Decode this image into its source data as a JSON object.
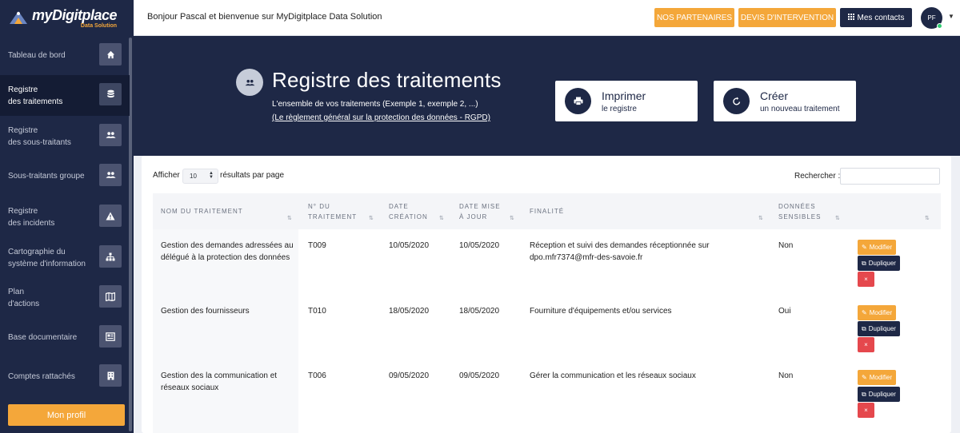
{
  "app": {
    "logo": {
      "main": "myDigitplace",
      "sub": "Data Solution"
    },
    "greeting": "Bonjour Pascal et bienvenue sur MyDigitplace Data Solution"
  },
  "topbar": {
    "partners_label": "NOS PARTENAIRES",
    "devis_label": "DEVIS D'INTERVENTION",
    "contacts_label": "Mes contacts",
    "avatar_initials": "PF"
  },
  "sidebar": {
    "items": [
      {
        "label": "Tableau de bord",
        "icon": "home-icon"
      },
      {
        "label": "Registre\ndes traitements",
        "icon": "database-icon"
      },
      {
        "label": "Registre\ndes sous-traitants",
        "icon": "users-icon"
      },
      {
        "label": "Sous-traitants groupe",
        "icon": "users-icon"
      },
      {
        "label": "Registre\ndes incidents",
        "icon": "warning-icon"
      },
      {
        "label": "Cartographie du\nsystème d'information",
        "icon": "sitemap-icon"
      },
      {
        "label": "Plan\nd'actions",
        "icon": "map-icon"
      },
      {
        "label": "Base documentaire",
        "icon": "newspaper-icon"
      },
      {
        "label": "Comptes rattachés",
        "icon": "building-icon"
      }
    ],
    "profile_label": "Mon profil"
  },
  "banner": {
    "title": "Registre des traitements",
    "subtitle": "L'ensemble de vos traitements (Exemple 1, exemple 2, ...)",
    "link": "(Le règlement général sur la protection des données - RGPD)",
    "print_title": "Imprimer",
    "print_sub": "le registre",
    "create_title": "Créer",
    "create_sub": "un nouveau traitement"
  },
  "table": {
    "show_label": "Afficher",
    "page_size": "10",
    "after_label": "résultats par page",
    "search_label": "Rechercher :",
    "search_value": "",
    "headers": {
      "name": "Nom du traitement",
      "number": "N° du\ntraitement",
      "created": "Date\ncréation",
      "updated": "Date mise\nà jour",
      "purpose": "Finalité",
      "sensitive": "Données\nsensibles"
    },
    "actions": {
      "modify": "Modifier",
      "duplicate": "Dupliquer",
      "delete": "×"
    },
    "rows": [
      {
        "name": "Gestion des demandes adressées au délégué à la protection des données",
        "number": "T009",
        "created": "10/05/2020",
        "updated": "10/05/2020",
        "purpose": "Réception et suivi des demandes réceptionnée sur dpo.mfr7374@mfr-des-savoie.fr",
        "sensitive": "Non"
      },
      {
        "name": "Gestion des fournisseurs",
        "number": "T010",
        "created": "18/05/2020",
        "updated": "18/05/2020",
        "purpose": "Fourniture d'équipements et/ou services",
        "sensitive": "Oui"
      },
      {
        "name": "Gestion des la communication et réseaux sociaux",
        "number": "T006",
        "created": "09/05/2020",
        "updated": "09/05/2020",
        "purpose": "Gérer la communication et les réseaux sociaux",
        "sensitive": "Non"
      }
    ]
  },
  "colors": {
    "navy": "#1e2846",
    "orange": "#f4a73a",
    "red": "#e5484d"
  }
}
